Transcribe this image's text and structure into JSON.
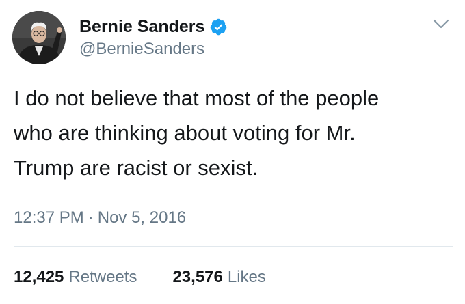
{
  "tweet": {
    "author": {
      "display_name": "Bernie Sanders",
      "handle": "@BernieSanders",
      "verified": true
    },
    "text_lines": [
      "I do not believe that most of the people",
      "who are thinking about voting for Mr.",
      "Trump are racist or sexist."
    ],
    "time": "12:37 PM",
    "separator": "·",
    "date": "Nov 5, 2016",
    "retweets": {
      "count": "12,425",
      "label": "Retweets"
    },
    "likes": {
      "count": "23,576",
      "label": "Likes"
    }
  },
  "icons": {
    "verified": "verified-badge-icon",
    "menu": "chevron-down-icon"
  },
  "colors": {
    "verified_blue": "#1da1f2",
    "secondary_text": "#657786",
    "primary_text": "#14171a",
    "divider": "#e1e8ed"
  }
}
